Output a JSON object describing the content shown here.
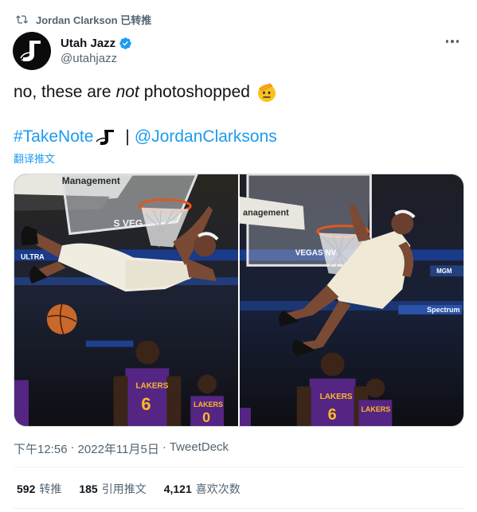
{
  "retweet": {
    "text": "Jordan Clarkson 已转推"
  },
  "author": {
    "display_name": "Utah Jazz",
    "handle": "@utahjazz"
  },
  "tweet": {
    "text_before": "no, these are",
    "text_italic": "not",
    "text_after": "photoshopped",
    "hashtag": "#TakeNote",
    "separator": "|",
    "mention": "@JordanClarksons",
    "translate_label": "翻译推文"
  },
  "photos": [
    {
      "banner_top": "Management",
      "banner_left": "ULTRA",
      "board_text": "S VEG"
    },
    {
      "banner_top": "anagement",
      "board_text": "VEGAS NV",
      "sponsor1": "MGM",
      "sponsor2": "Spectrum"
    }
  ],
  "meta": {
    "time": "下午12:56",
    "date": "2022年11月5日",
    "dot": "·",
    "source": "TweetDeck"
  },
  "stats": [
    {
      "count": "592",
      "label": "转推"
    },
    {
      "count": "185",
      "label": "引用推文"
    },
    {
      "count": "4,121",
      "label": "喜欢次数"
    }
  ],
  "colors": {
    "link": "#1d9bf0",
    "muted": "#536471",
    "lakers_purple": "#552583",
    "lakers_gold": "#fdb927"
  }
}
